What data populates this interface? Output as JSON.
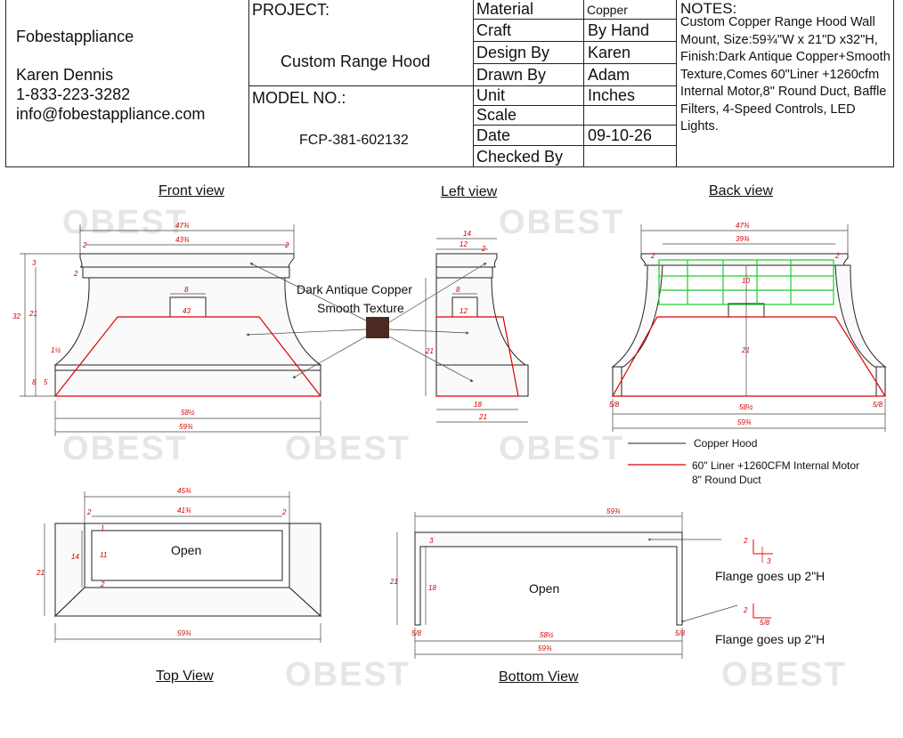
{
  "company": {
    "name": "Fobestappliance",
    "contact": "Karen Dennis",
    "phone": "1-833-223-3282",
    "email": "info@fobestappliance.com"
  },
  "project": {
    "label": "PROJECT:",
    "name": "Custom Range Hood",
    "model_label": "MODEL NO.:",
    "model": "FCP-381-602132"
  },
  "spec_table": {
    "rows": [
      {
        "label": "Material",
        "value": "Copper"
      },
      {
        "label": "Craft",
        "value": "By Hand"
      },
      {
        "label": "Design By",
        "value": "Karen"
      },
      {
        "label": "Drawn By",
        "value": "Adam"
      },
      {
        "label": "Unit",
        "value": "Inches"
      },
      {
        "label": "Scale",
        "value": ""
      },
      {
        "label": "Date",
        "value": "09-10-26"
      },
      {
        "label": "Checked By",
        "value": ""
      }
    ]
  },
  "notes": {
    "title": "NOTES:",
    "text": "Custom Copper Range Hood Wall Mount, Size:59¾\"W x 21\"D x32\"H, Finish:Dark Antique Copper+Smooth Texture,Comes 60\"Liner +1260cfm Internal Motor,8\" Round Duct, Baffle Filters, 4-Speed Controls, LED Lights."
  },
  "views": {
    "front": "Front view",
    "left": "Left view",
    "back": "Back view",
    "top": "Top View",
    "bottom": "Bottom View"
  },
  "finish_callout": {
    "line1": "Dark Antique Copper",
    "line2": "Smooth Texture",
    "swatch_color": "#4a2a22"
  },
  "legend": {
    "hood": "Copper Hood",
    "liner_line1": "60\" Liner +1260CFM Internal Motor",
    "liner_line2": "8\" Round Duct"
  },
  "labels": {
    "open_top": "Open",
    "open_bottom": "Open",
    "flange1": "Flange goes up 2\"H",
    "flange2": "Flange goes up 2\"H"
  },
  "dims": {
    "front": {
      "w_top": "47¾",
      "w_inner": "43¾",
      "side": "2",
      "side_r": "2",
      "h_total": "32",
      "h_21": "21",
      "top_3": "3",
      "top_2": "2",
      "slope": "1½",
      "band_8": "8",
      "band_5": "5",
      "duct_w": "8",
      "duct_43": "43",
      "base_inner": "58½",
      "base_total": "59¾"
    },
    "left": {
      "top_14": "14",
      "top_12": "12",
      "side_2": "2",
      "duct_8": "8",
      "duct_12": "12",
      "h_21": "21",
      "base_18": "18",
      "base_21": "21"
    },
    "back": {
      "w_top": "47¾",
      "w_inner": "39¾",
      "side": "2",
      "side_r": "2",
      "mid_10": "10",
      "h_21": "21",
      "base_l": "5/8",
      "base_r": "5/8",
      "base_inner": "58½",
      "base_total": "59¾"
    },
    "top": {
      "w_outer": "45¾",
      "w_inner": "41¾",
      "side_l": "2",
      "side_r": "2",
      "d_14": "14",
      "d_11": "11",
      "d_21": "21",
      "d_1": "1",
      "d_2": "2",
      "w_total": "59¾"
    },
    "bottom": {
      "w_total": "59¾",
      "top_3": "3",
      "h_21": "21",
      "h_18": "18",
      "base_l": "5/8",
      "base_r": "5/8",
      "base_inner": "58½",
      "base_total": "59¾",
      "fl_2a": "2",
      "fl_3": "3",
      "fl_2b": "2",
      "fl_5": "5/8"
    }
  },
  "watermark": "OBEST"
}
